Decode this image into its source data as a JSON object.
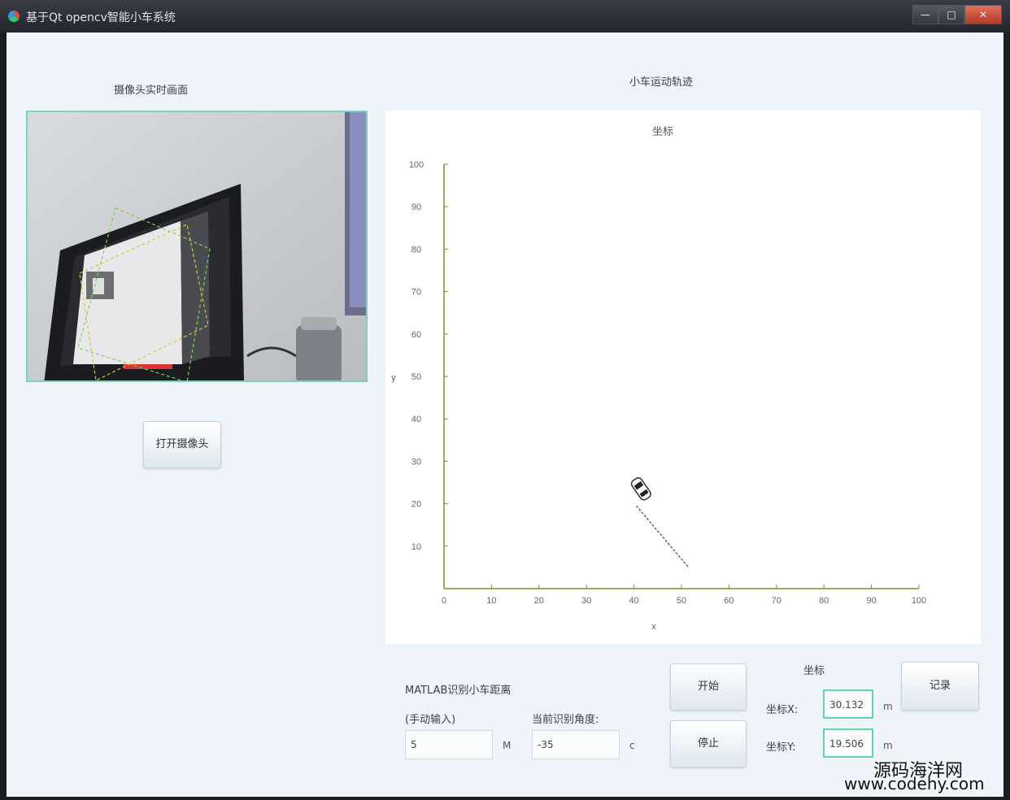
{
  "window": {
    "title": "基于Qt opencv智能小车系统",
    "minimize_icon": "minimize-icon",
    "maximize_icon": "maximize-icon",
    "close_icon": "close-icon"
  },
  "camera": {
    "heading": "摄像头实时画面",
    "open_button": "打开摄像头"
  },
  "trajectory": {
    "heading": "小车运动轨迹",
    "chart_data": {
      "type": "scatter",
      "title": "坐标",
      "xlabel": "x",
      "ylabel": "y",
      "xlim": [
        0,
        100
      ],
      "ylim": [
        0,
        100
      ],
      "x_ticks": [
        "0",
        "10",
        "20",
        "30",
        "40",
        "50",
        "60",
        "70",
        "80",
        "90",
        "100"
      ],
      "y_ticks": [
        "10",
        "20",
        "30",
        "40",
        "50",
        "60",
        "70",
        "80",
        "90",
        "100"
      ],
      "grid": false,
      "path": [
        {
          "x": 40.5,
          "y": 19.5
        },
        {
          "x": 51.5,
          "y": 5.0
        }
      ],
      "car": {
        "x": 41.5,
        "y": 23.5
      }
    }
  },
  "controls": {
    "distance_label": "MATLAB识别小车距离",
    "manual_label": "(手动输入)",
    "manual_value": "5",
    "manual_unit": "M",
    "angle_label": "当前识别角度:",
    "angle_value": "-35",
    "angle_unit": "c",
    "start_button": "开始",
    "stop_button": "停止",
    "coord_heading": "坐标",
    "coord_x_label": "坐标X:",
    "coord_x_value": "30.132",
    "coord_x_unit": "m",
    "coord_y_label": "坐标Y:",
    "coord_y_value": "19.506",
    "coord_y_unit": "m",
    "record_button": "记录"
  },
  "watermark": {
    "line1": "源码海洋网",
    "line2": "www.codehy.com"
  }
}
